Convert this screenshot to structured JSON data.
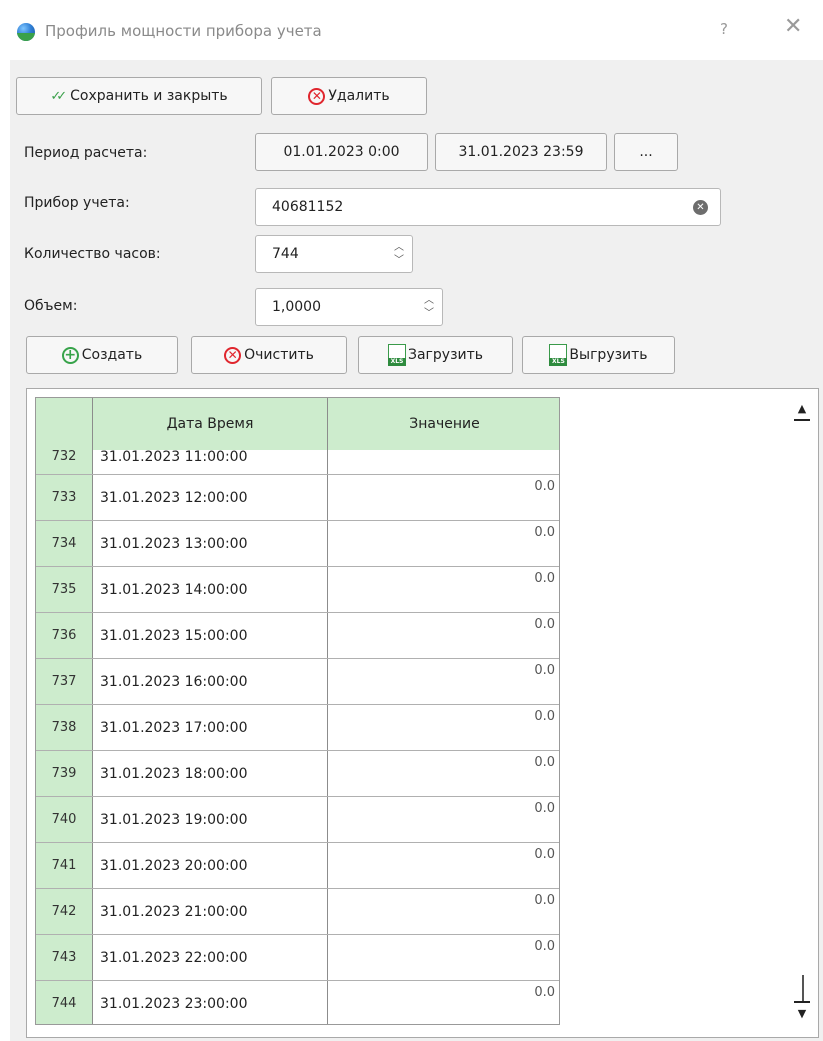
{
  "window": {
    "title": "Профиль мощности прибора учета",
    "help": "?",
    "close": "✕"
  },
  "toolbar": {
    "save_close_label": "Сохранить и закрыть",
    "delete_label": "Удалить"
  },
  "form": {
    "period_label": "Период расчета:",
    "period_from": "01.01.2023 0:00",
    "period_to": "31.01.2023 23:59",
    "period_more": "...",
    "meter_label": "Прибор учета:",
    "meter_value": "40681152",
    "hours_label": "Количество часов:",
    "hours_value": "744",
    "volume_label": "Объем:",
    "volume_value": "1,0000"
  },
  "actions": {
    "create_label": "Создать",
    "clear_label": "Очистить",
    "load_label": "Загрузить",
    "export_label": "Выгрузить"
  },
  "table": {
    "columns": [
      "Дата Время",
      "Значение"
    ],
    "partial_row": {
      "num": "732",
      "datetime": "31.01.2023 11:00:00"
    },
    "rows": [
      {
        "num": "733",
        "datetime": "31.01.2023 12:00:00",
        "value": "0.0"
      },
      {
        "num": "734",
        "datetime": "31.01.2023 13:00:00",
        "value": "0.0"
      },
      {
        "num": "735",
        "datetime": "31.01.2023 14:00:00",
        "value": "0.0"
      },
      {
        "num": "736",
        "datetime": "31.01.2023 15:00:00",
        "value": "0.0"
      },
      {
        "num": "737",
        "datetime": "31.01.2023 16:00:00",
        "value": "0.0"
      },
      {
        "num": "738",
        "datetime": "31.01.2023 17:00:00",
        "value": "0.0"
      },
      {
        "num": "739",
        "datetime": "31.01.2023 18:00:00",
        "value": "0.0"
      },
      {
        "num": "740",
        "datetime": "31.01.2023 19:00:00",
        "value": "0.0"
      },
      {
        "num": "741",
        "datetime": "31.01.2023 20:00:00",
        "value": "0.0"
      },
      {
        "num": "742",
        "datetime": "31.01.2023 21:00:00",
        "value": "0.0"
      },
      {
        "num": "743",
        "datetime": "31.01.2023 22:00:00",
        "value": "0.0"
      },
      {
        "num": "744",
        "datetime": "31.01.2023 23:00:00",
        "value": "0.0"
      }
    ]
  },
  "colors": {
    "header_green": "#cdeccd",
    "delete_red": "#e0262e",
    "add_green": "#37a34a"
  },
  "icons": {
    "app": "app-globe-icon",
    "save": "double-check-icon",
    "delete": "delete-x-circle-icon",
    "create": "plus-circle-icon",
    "clear": "clear-x-circle-icon",
    "xls": "xls-file-icon",
    "meter_clear": "clear-field-icon",
    "spin": "spin-arrows-icon",
    "scroll_up": "scroll-up-arrow-icon",
    "scroll_down": "scroll-down-arrow-icon"
  }
}
